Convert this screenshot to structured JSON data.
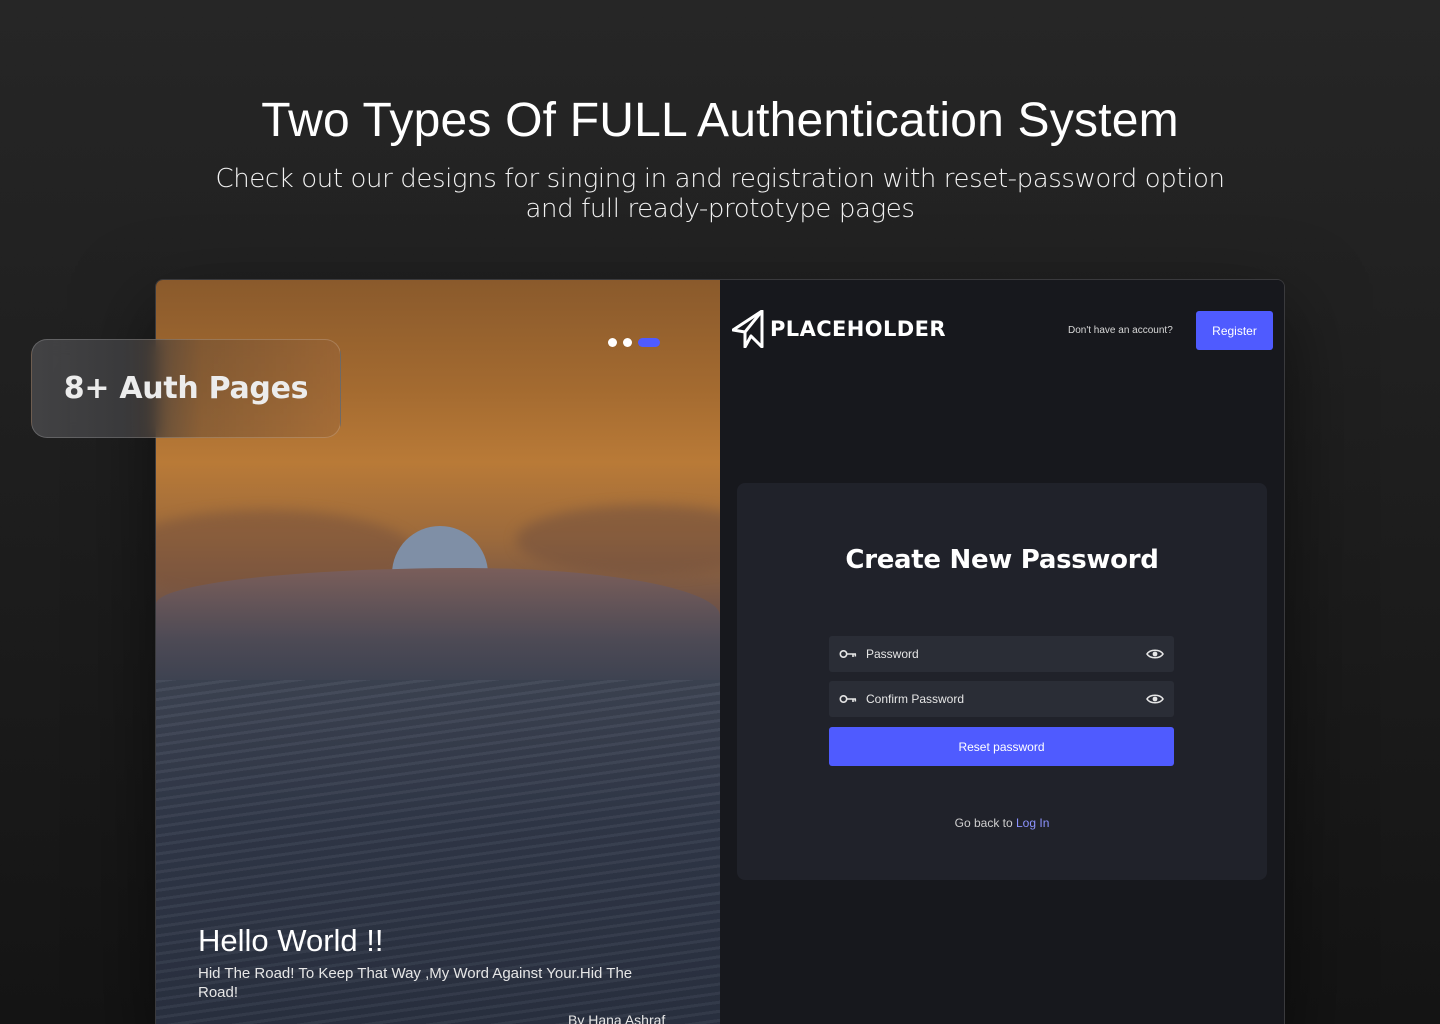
{
  "header": {
    "title": "Two Types Of FULL Authentication System",
    "subtitle": "Check out our designs for singing in and registration with reset-password option and full ready-prototype pages"
  },
  "badge": {
    "label": "8+ Auth Pages"
  },
  "hero": {
    "title": "Hello World !!",
    "text": "Hid The Road! To Keep That Way ,My Word Against Your.Hid The Road!",
    "author": "By Hana Ashraf",
    "carousel": {
      "total": 3,
      "active_index": 2
    }
  },
  "auth": {
    "logo_text": "PLACEHOLDER",
    "no_account_text": "Don't have an account?",
    "register_label": "Register",
    "card_title": "Create New Password",
    "password_placeholder": "Password",
    "confirm_placeholder": "Confirm Password",
    "reset_label": "Reset password",
    "back_text": "Go back to",
    "login_link": "Log In"
  },
  "colors": {
    "accent": "#4f5bff",
    "panel_bg": "#17181d",
    "card_bg": "#20222a",
    "field_bg": "#2a2d36",
    "link": "#8c93ff"
  },
  "icons": {
    "logo": "paper-plane-icon",
    "field": "key-icon",
    "toggle": "eye-icon"
  }
}
